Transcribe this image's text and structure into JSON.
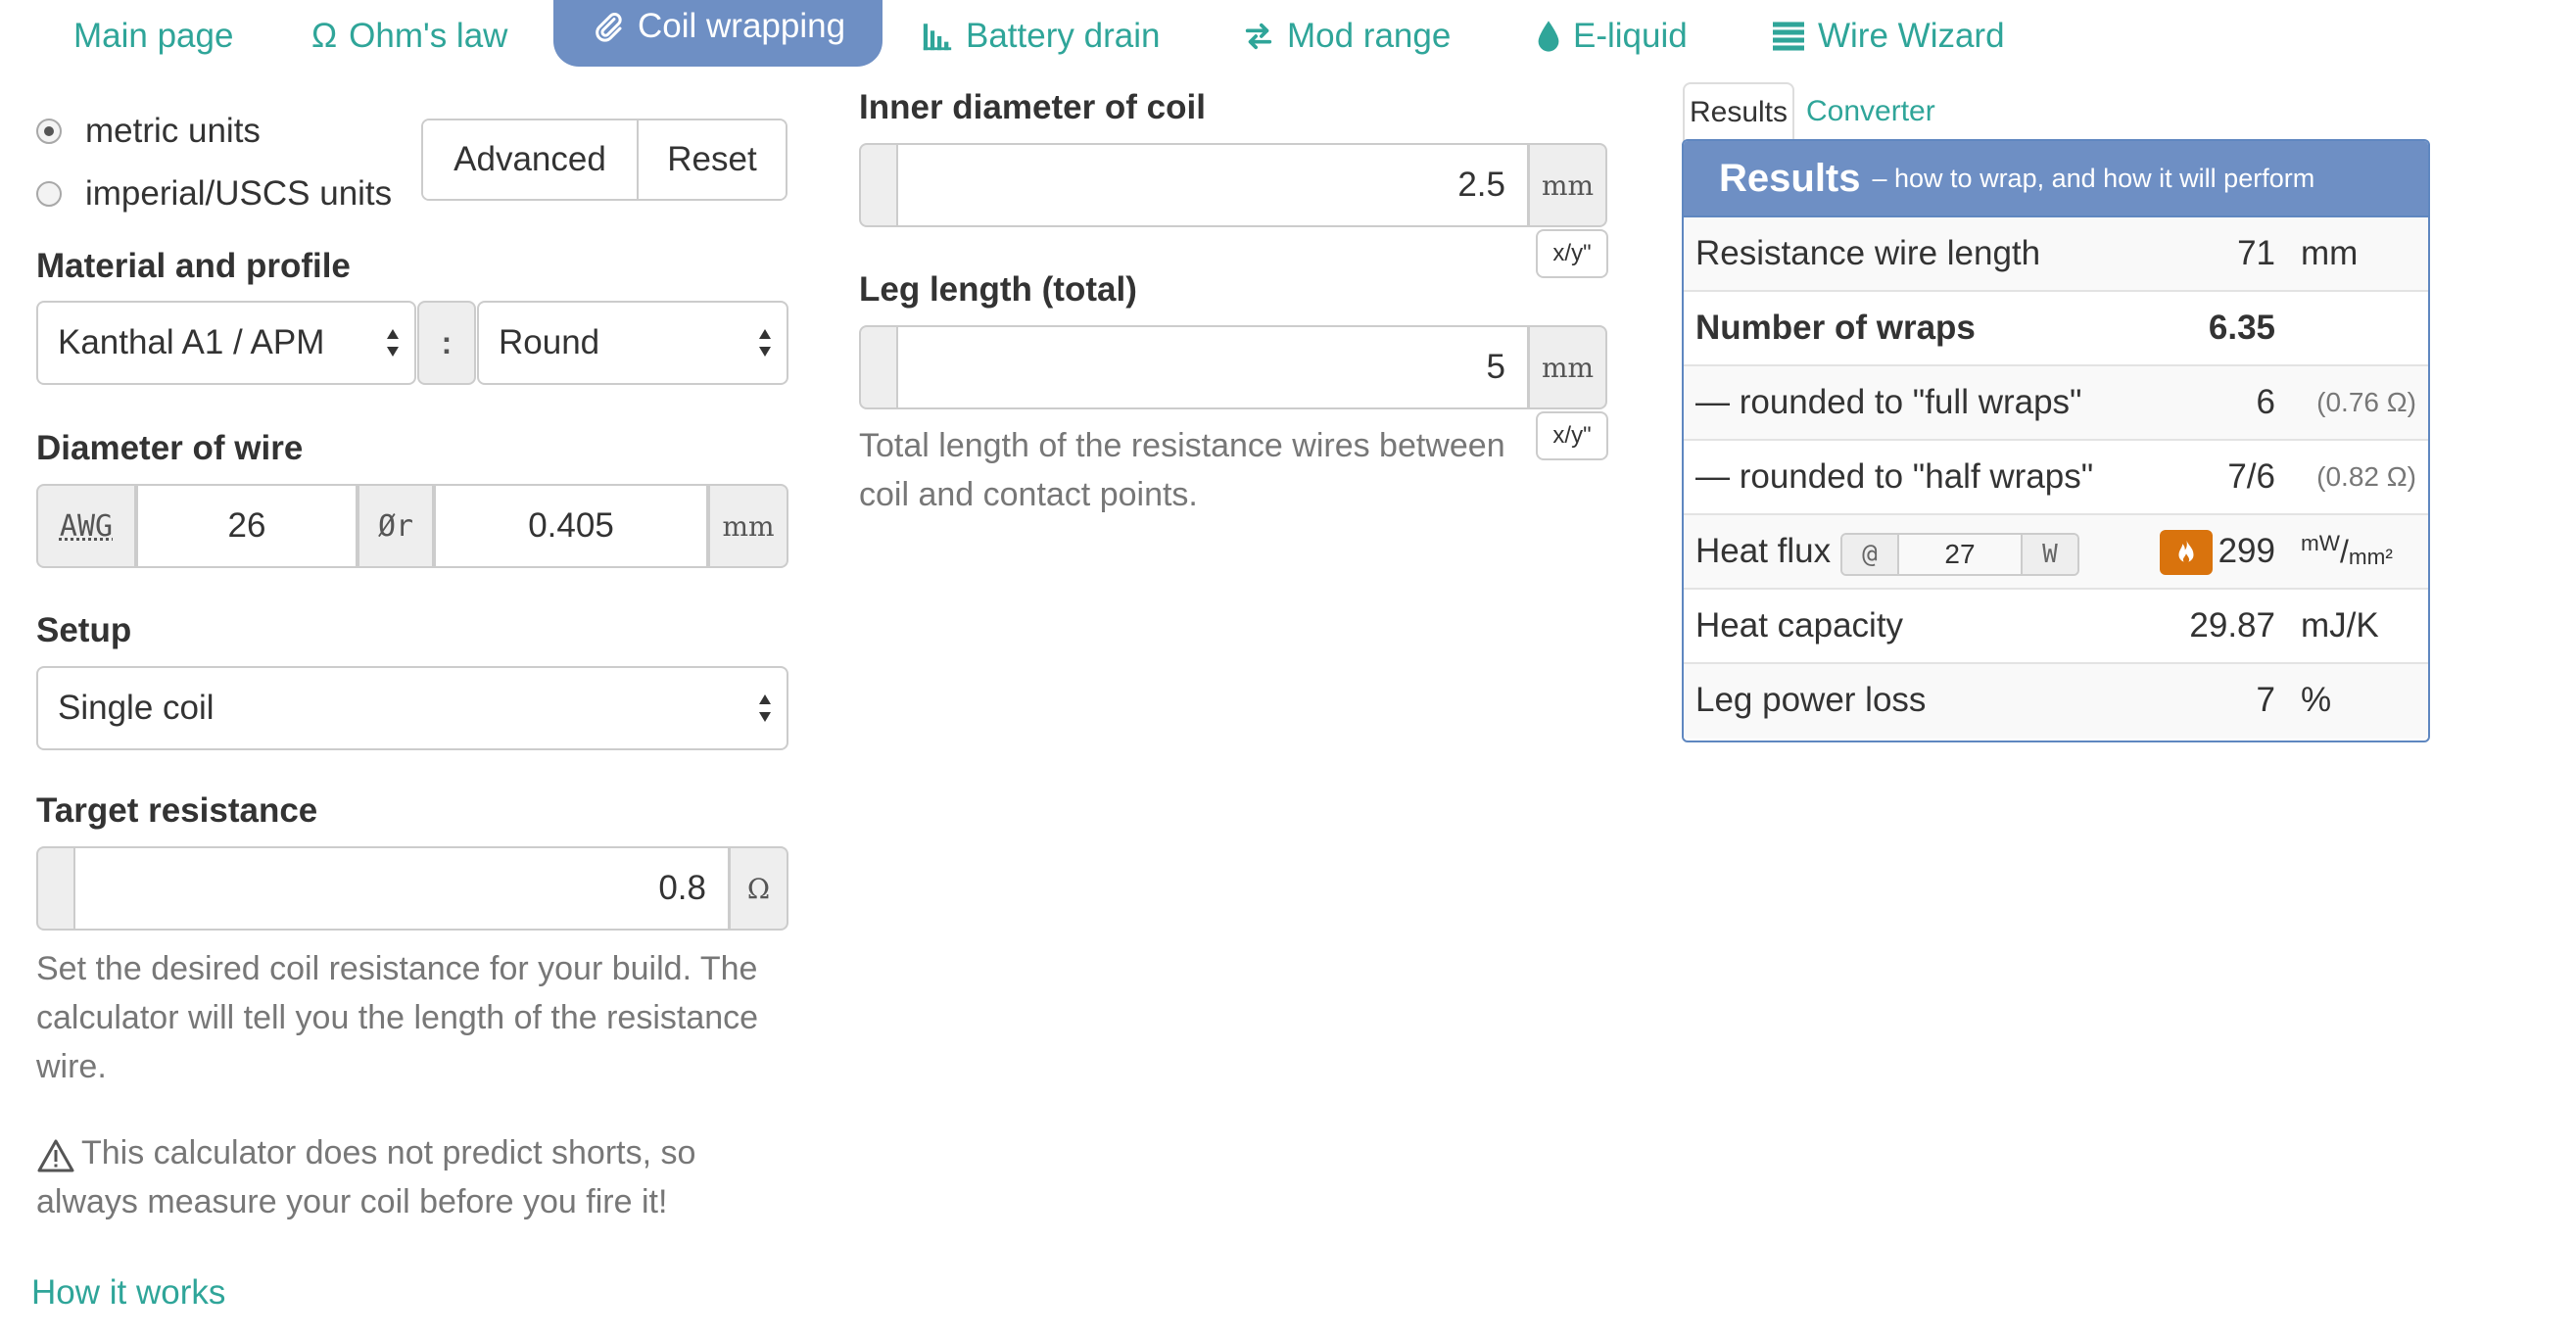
{
  "nav": {
    "items": [
      {
        "label": "Main page",
        "icon": "none"
      },
      {
        "label": "Ohm's law",
        "icon": "omega-icon"
      },
      {
        "label": "Coil wrapping",
        "icon": "paperclip-icon"
      },
      {
        "label": "Battery drain",
        "icon": "bar-chart-icon"
      },
      {
        "label": "Mod range",
        "icon": "swap-arrows-icon"
      },
      {
        "label": "E-liquid",
        "icon": "drop-icon"
      },
      {
        "label": "Wire Wizard",
        "icon": "list-icon"
      }
    ],
    "omega_glyph": "Ω",
    "active": "Coil wrapping"
  },
  "units": {
    "metric": "metric units",
    "imperial": "imperial/USCS units",
    "selected": "metric"
  },
  "buttons": {
    "advanced": "Advanced",
    "reset": "Reset"
  },
  "material": {
    "label": "Material and profile",
    "material_value": "Kanthal A1 / APM",
    "separator": ":",
    "profile_value": "Round"
  },
  "wire_diameter": {
    "label": "Diameter of wire",
    "awg_label": "AWG",
    "awg_value": "26",
    "diam_symbol": "Ør",
    "mm_value": "0.405",
    "unit": "mm"
  },
  "setup": {
    "label": "Setup",
    "value": "Single coil"
  },
  "target_resistance": {
    "label": "Target resistance",
    "value": "0.8",
    "unit": "Ω",
    "help": "Set the desired coil resistance for your build. The calculator will tell you the length of the resistance wire."
  },
  "warning": {
    "text": "This calculator does not predict shorts, so always measure your coil before you fire it!",
    "icon": "warning-triangle-icon"
  },
  "how_it_works": "How it works",
  "inner_diameter": {
    "label": "Inner diameter of coil",
    "value": "2.5",
    "unit": "mm",
    "toggle": "x/y\""
  },
  "leg_length": {
    "label": "Leg length (total)",
    "value": "5",
    "unit": "mm",
    "toggle": "x/y\"",
    "help": "Total length of the resistance wires between coil and contact points."
  },
  "results_tabs": {
    "active": "Results",
    "other": "Converter"
  },
  "results": {
    "title": "Results",
    "subtitle": "– how to wrap, and how it will perform",
    "rows": [
      {
        "label": "Resistance wire length",
        "value": "71",
        "unit": "mm"
      },
      {
        "label": "Number of wraps",
        "value": "6.35"
      },
      {
        "label": "— rounded to \"full wraps\"",
        "value": "6",
        "note": "(0.76 Ω)"
      },
      {
        "label": "— rounded to \"half wraps\"",
        "value": "7/6",
        "note": "(0.82 Ω)"
      },
      {
        "label": "Heat flux",
        "at": "@",
        "watts": "27",
        "watt_unit": "W",
        "value": "299",
        "unit_num": "mW",
        "unit_den": "mm²",
        "icon": "flame-icon"
      },
      {
        "label": "Heat capacity",
        "value": "29.87",
        "unit": "mJ/K"
      },
      {
        "label": "Leg power loss",
        "value": "7",
        "unit": "%"
      }
    ]
  },
  "colors": {
    "accent": "#2fa599",
    "active_tab": "#6e8fc4",
    "flame": "#d9730d"
  }
}
